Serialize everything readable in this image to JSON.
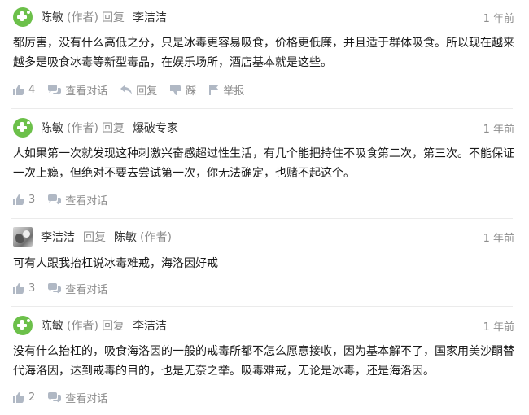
{
  "colors": {
    "avatar_green": "#6cc04a",
    "meta_gray": "#8c8c8c",
    "icon_gray": "#b0b8c4",
    "text": "#1a1a1a",
    "divider": "#ebebeb"
  },
  "labels": {
    "author_tag": "(作者)",
    "reply": "回复",
    "view_conversation": "查看对话",
    "reply_action": "回复",
    "dislike_action": "踩",
    "report_action": "举报"
  },
  "comments": [
    {
      "author": "陈敏",
      "author_is_op": true,
      "reply_to": "李洁洁",
      "reply_to_is_op": false,
      "time": "1 年前",
      "text": "都厉害，没有什么高低之分，只是冰毒更容易吸食，价格更低廉，并且适于群体吸食。所以现在越来越多是吸食冰毒等新型毒品，在娱乐场所，酒店基本就是这些。",
      "likes": "4",
      "avatar_icon": "plus-leaf-icon"
    },
    {
      "author": "陈敏",
      "author_is_op": true,
      "reply_to": "爆破专家",
      "reply_to_is_op": false,
      "time": "1 年前",
      "text": "人如果第一次就发现这种刺激兴奋感超过性生活，有几个能把持住不吸食第二次，第三次。不能保证一次上瘾，但绝对不要去尝试第一次，你无法确定，也赌不起这个。",
      "likes": "3",
      "avatar_icon": "plus-leaf-icon"
    },
    {
      "author": "李洁洁",
      "author_is_op": false,
      "reply_to": "陈敏",
      "reply_to_is_op": true,
      "time": "1 年前",
      "text": "可有人跟我抬杠说冰毒难戒，海洛因好戒",
      "likes": "3",
      "avatar_icon": "photo-avatar"
    },
    {
      "author": "陈敏",
      "author_is_op": true,
      "reply_to": "李洁洁",
      "reply_to_is_op": false,
      "time": "1 年前",
      "text": "没有什么抬杠的，吸食海洛因的一般的戒毒所都不怎么愿意接收，因为基本解不了，国家用美沙酮替代海洛因，达到戒毒的目的，也是无奈之举。吸毒难戒，无论是冰毒，还是海洛因。",
      "likes": "2",
      "avatar_icon": "plus-leaf-icon"
    }
  ]
}
